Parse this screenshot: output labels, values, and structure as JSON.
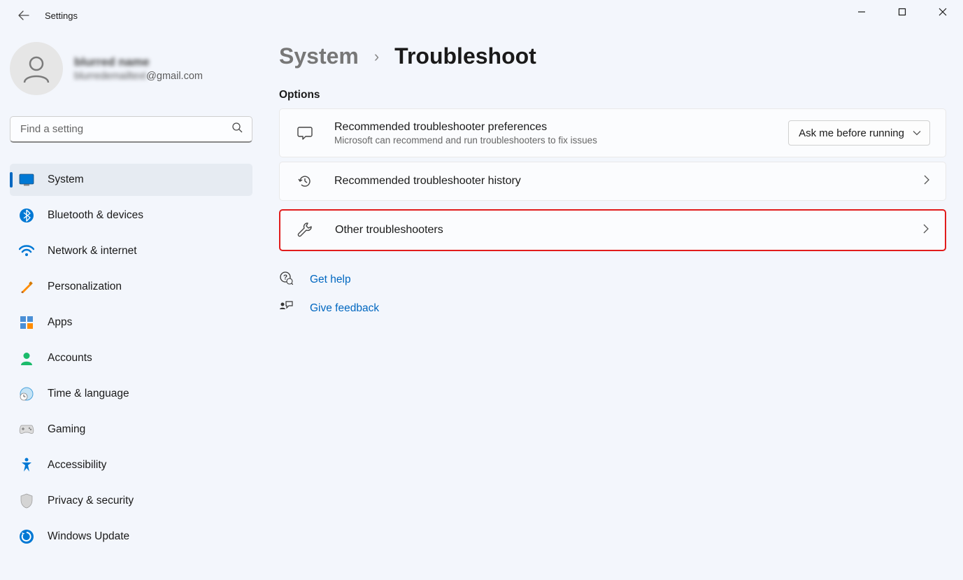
{
  "titlebar": {
    "title": "Settings"
  },
  "profile": {
    "name": "blurred name",
    "email_visible": "@gmail.com"
  },
  "search": {
    "placeholder": "Find a setting"
  },
  "nav": [
    {
      "label": "System",
      "active": true
    },
    {
      "label": "Bluetooth & devices"
    },
    {
      "label": "Network & internet"
    },
    {
      "label": "Personalization"
    },
    {
      "label": "Apps"
    },
    {
      "label": "Accounts"
    },
    {
      "label": "Time & language"
    },
    {
      "label": "Gaming"
    },
    {
      "label": "Accessibility"
    },
    {
      "label": "Privacy & security"
    },
    {
      "label": "Windows Update"
    }
  ],
  "breadcrumb": {
    "parent": "System",
    "current": "Troubleshoot"
  },
  "section_label": "Options",
  "cards": {
    "recommended_prefs": {
      "title": "Recommended troubleshooter preferences",
      "sub": "Microsoft can recommend and run troubleshooters to fix issues",
      "dropdown_value": "Ask me before running"
    },
    "history": {
      "title": "Recommended troubleshooter history"
    },
    "other": {
      "title": "Other troubleshooters"
    }
  },
  "help": {
    "get_help": "Get help",
    "give_feedback": "Give feedback"
  }
}
